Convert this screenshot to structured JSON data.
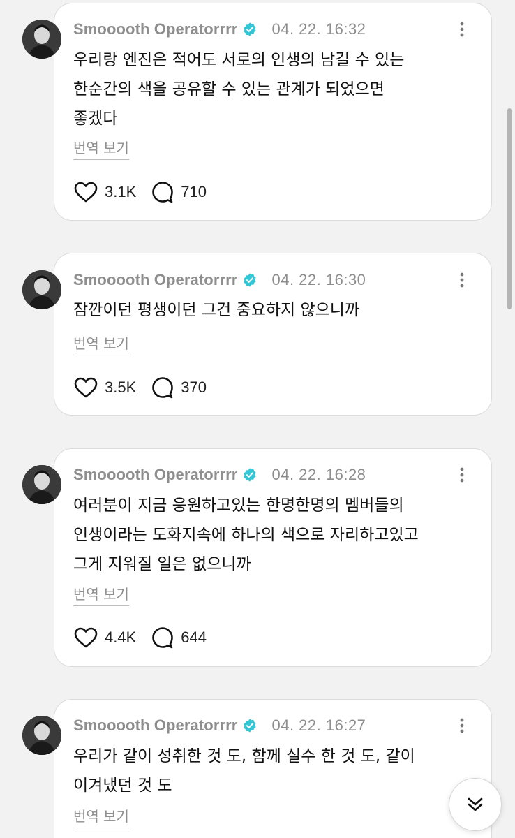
{
  "colors": {
    "background": "#f2f2f2",
    "card": "#ffffff",
    "meta_text": "#8e8e8e",
    "verified": "#35c6d6"
  },
  "posts": [
    {
      "author": "Smooooth Operatorrrr",
      "verified_icon": "verified-badge-icon",
      "timestamp": "04. 22. 16:32",
      "text": "우리랑 엔진은 적어도 서로의 인생의 남길 수 있는\n한순간의 색을 공유할 수 있는 관계가 되었으면\n좋겠다",
      "translate_label": "번역 보기",
      "likes": "3.1K",
      "replies": "710"
    },
    {
      "author": "Smooooth Operatorrrr",
      "verified_icon": "verified-badge-icon",
      "timestamp": "04. 22. 16:30",
      "text": "잠깐이던 평생이던 그건 중요하지 않으니까",
      "translate_label": "번역 보기",
      "likes": "3.5K",
      "replies": "370"
    },
    {
      "author": "Smooooth Operatorrrr",
      "verified_icon": "verified-badge-icon",
      "timestamp": "04. 22. 16:28",
      "text": "여러분이 지금 응원하고있는 한명한명의 멤버들의\n인생이라는 도화지속에 하나의 색으로 자리하고있고\n그게 지워질 일은 없으니까",
      "translate_label": "번역 보기",
      "likes": "4.4K",
      "replies": "644"
    },
    {
      "author": "Smooooth Operatorrrr",
      "verified_icon": "verified-badge-icon",
      "timestamp": "04. 22. 16:27",
      "text": "우리가 같이 성취한 것 도, 함께 실수 한 것 도, 같이\n이겨냈던 것 도",
      "translate_label": "번역 보기"
    }
  ],
  "scroll_down_icon": "double-chevron-down-icon"
}
